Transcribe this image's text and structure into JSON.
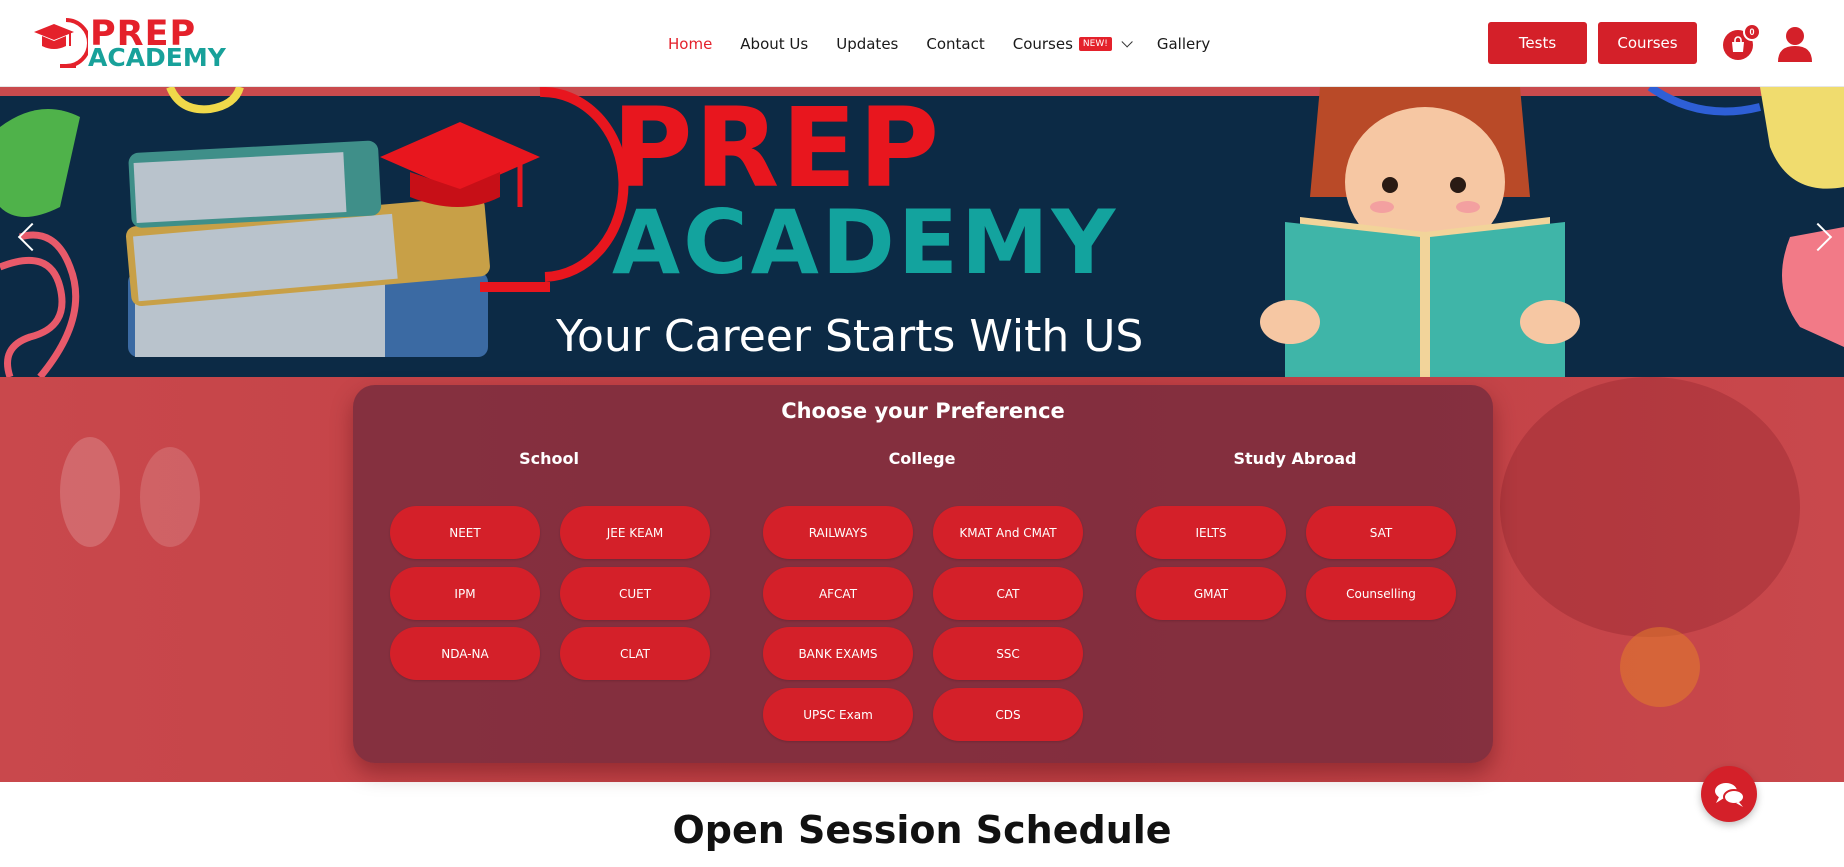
{
  "brand": {
    "logo_line1": "PREP",
    "logo_line2": "ACADEMY"
  },
  "nav": {
    "items": [
      {
        "label": "Home",
        "active": true
      },
      {
        "label": "About Us"
      },
      {
        "label": "Updates"
      },
      {
        "label": "Contact"
      },
      {
        "label": "Courses",
        "badge": "NEW!",
        "has_dropdown": true
      },
      {
        "label": "Gallery"
      }
    ]
  },
  "header_buttons": {
    "tests": "Tests",
    "courses": "Courses"
  },
  "cart": {
    "count": "0",
    "icon": "shopping-bag-icon"
  },
  "user": {
    "icon": "user-icon"
  },
  "banner": {
    "title_line1": "PREP",
    "title_line2": "ACADEMY",
    "tagline": "Your Career Starts With US"
  },
  "preference": {
    "title": "Choose your Preference",
    "columns": [
      {
        "title": "School",
        "items": [
          "NEET",
          "JEE KEAM",
          "IPM",
          "CUET",
          "NDA-NA",
          "CLAT"
        ]
      },
      {
        "title": "College",
        "items": [
          "RAILWAYS",
          "KMAT And CMAT",
          "AFCAT",
          "CAT",
          "BANK EXAMS",
          "SSC",
          "UPSC Exam",
          "CDS"
        ]
      },
      {
        "title": "Study Abroad",
        "items": [
          "IELTS",
          "SAT",
          "GMAT",
          "Counselling"
        ]
      }
    ]
  },
  "section": {
    "title": "Open Session Schedule"
  },
  "colors": {
    "accent": "#d42029",
    "teal": "#18a19a",
    "banner_bg": "#0c2a45"
  }
}
